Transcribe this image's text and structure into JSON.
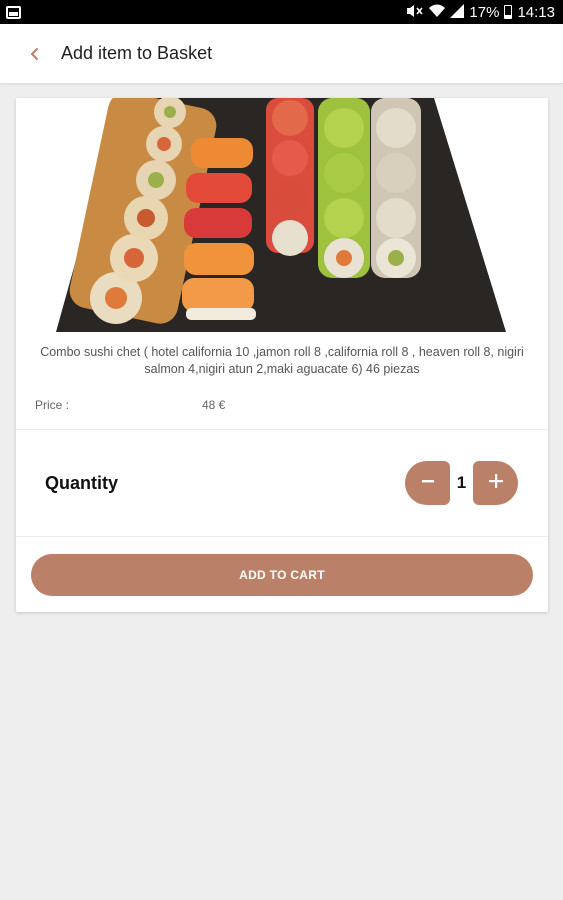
{
  "status_bar": {
    "battery_percent": "17%",
    "time": "14:13",
    "icons": [
      "image-icon",
      "mute-icon",
      "wifi-icon",
      "signal-icon",
      "battery-icon"
    ]
  },
  "app_bar": {
    "back_icon": "chevron-left-icon",
    "title": "Add item to Basket"
  },
  "product": {
    "image_name": "sushi-combo-photo",
    "description": "Combo sushi chet ( hotel california 10 ,jamon roll 8 ,california roll 8 , heaven roll 8, nigiri salmon 4,nigiri atun 2,maki aguacate 6)  46 piezas",
    "price_label": "Price :",
    "price_value": "48 €"
  },
  "quantity": {
    "label": "Quantity",
    "value": "1",
    "minus_icon": "minus-icon",
    "plus_icon": "plus-icon"
  },
  "cart": {
    "button_label": "ADD TO CART"
  },
  "colors": {
    "accent": "#bb8068",
    "background": "#eeeeee",
    "status_bar": "#000000"
  }
}
